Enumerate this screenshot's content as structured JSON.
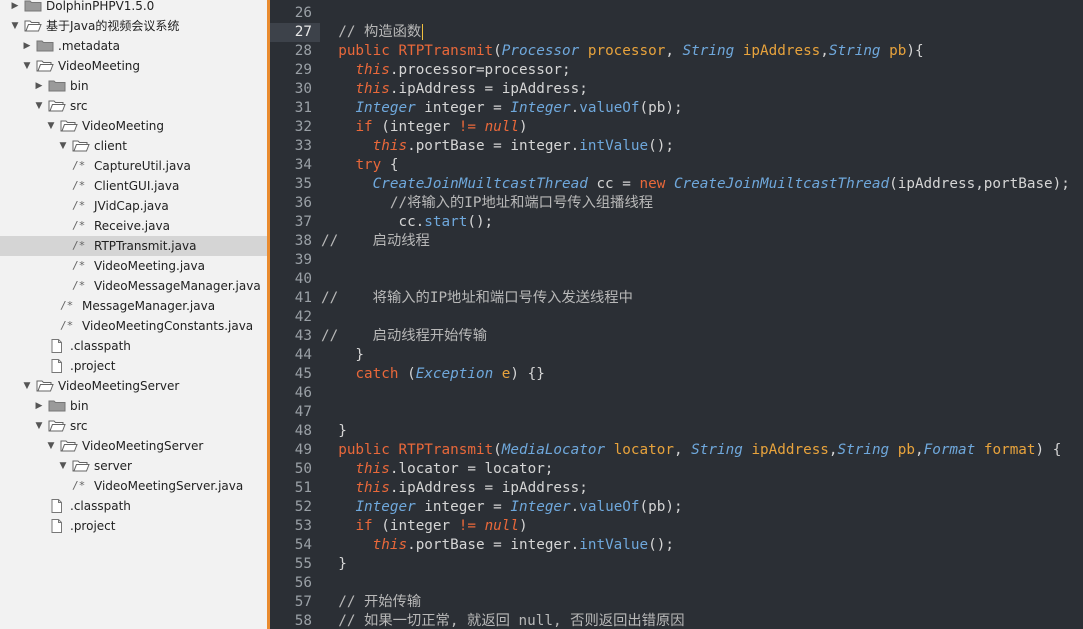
{
  "sidebar": {
    "items": [
      {
        "label": "DolphinPHPV1.5.0",
        "kind": "folder",
        "depth": 0,
        "expanded": false,
        "arrow": true
      },
      {
        "label": "基于Java的视频会议系统",
        "kind": "folder",
        "depth": 0,
        "expanded": true,
        "arrow": true
      },
      {
        "label": ".metadata",
        "kind": "folder",
        "depth": 1,
        "expanded": false,
        "arrow": true
      },
      {
        "label": "VideoMeeting",
        "kind": "folder",
        "depth": 1,
        "expanded": true,
        "arrow": true
      },
      {
        "label": "bin",
        "kind": "folder",
        "depth": 2,
        "expanded": false,
        "arrow": true
      },
      {
        "label": "src",
        "kind": "folder",
        "depth": 2,
        "expanded": true,
        "arrow": true
      },
      {
        "label": "VideoMeeting",
        "kind": "folder",
        "depth": 3,
        "expanded": true,
        "arrow": true
      },
      {
        "label": "client",
        "kind": "folder",
        "depth": 4,
        "expanded": true,
        "arrow": true
      },
      {
        "label": "CaptureUtil.java",
        "kind": "java",
        "depth": 5
      },
      {
        "label": "ClientGUI.java",
        "kind": "java",
        "depth": 5
      },
      {
        "label": "JVidCap.java",
        "kind": "java",
        "depth": 5
      },
      {
        "label": "Receive.java",
        "kind": "java",
        "depth": 5
      },
      {
        "label": "RTPTransmit.java",
        "kind": "java",
        "depth": 5,
        "selected": true
      },
      {
        "label": "VideoMeeting.java",
        "kind": "java",
        "depth": 5
      },
      {
        "label": "VideoMessageManager.java",
        "kind": "java",
        "depth": 5
      },
      {
        "label": "MessageManager.java",
        "kind": "java",
        "depth": 4
      },
      {
        "label": "VideoMeetingConstants.java",
        "kind": "java",
        "depth": 4
      },
      {
        "label": ".classpath",
        "kind": "file",
        "depth": 2
      },
      {
        "label": ".project",
        "kind": "file",
        "depth": 2
      },
      {
        "label": "VideoMeetingServer",
        "kind": "folder",
        "depth": 1,
        "expanded": true,
        "arrow": true
      },
      {
        "label": "bin",
        "kind": "folder",
        "depth": 2,
        "expanded": false,
        "arrow": true
      },
      {
        "label": "src",
        "kind": "folder",
        "depth": 2,
        "expanded": true,
        "arrow": true
      },
      {
        "label": "VideoMeetingServer",
        "kind": "folder",
        "depth": 3,
        "expanded": true,
        "arrow": true
      },
      {
        "label": "server",
        "kind": "folder",
        "depth": 4,
        "expanded": true,
        "arrow": true
      },
      {
        "label": "VideoMeetingServer.java",
        "kind": "java",
        "depth": 5
      },
      {
        "label": ".classpath",
        "kind": "file",
        "depth": 2
      },
      {
        "label": ".project",
        "kind": "file",
        "depth": 2
      }
    ],
    "java_icon_glyph": "/*"
  },
  "editor": {
    "current_line": 27,
    "lines": [
      {
        "n": "26",
        "html": ""
      },
      {
        "n": "27",
        "html": "  <span class=\"cm\">// 构造函数</span><span class=\"cursor\"></span>"
      },
      {
        "n": "28",
        "html": "  <span class=\"kw\">public</span> <span class=\"fn\">RTPTransmit</span>(<span class=\"ty\">Processor</span> <span class=\"prm\">processor</span>, <span class=\"ty\">String</span> <span class=\"prm\">ipAddress</span>,<span class=\"ty\">String</span> <span class=\"prm\">pb</span>){"
      },
      {
        "n": "29",
        "html": "    <span class=\"kw2\">this</span>.processor=processor;"
      },
      {
        "n": "30",
        "html": "    <span class=\"kw2\">this</span>.ipAddress = ipAddress;"
      },
      {
        "n": "31",
        "html": "    <span class=\"ty\">Integer</span> integer = <span class=\"ty\">Integer</span>.<span class=\"mt\">valueOf</span>(pb);"
      },
      {
        "n": "32",
        "html": "    <span class=\"kw\">if</span> (integer <span class=\"kw\">!=</span> <span class=\"kw2\">null</span>)"
      },
      {
        "n": "33",
        "html": "      <span class=\"kw2\">this</span>.portBase = integer.<span class=\"mt\">intValue</span>();"
      },
      {
        "n": "34",
        "html": "    <span class=\"kw\">try</span> {"
      },
      {
        "n": "35",
        "html": "      <span class=\"ty\">CreateJoinMuiltcastThread</span> cc = <span class=\"kw\">new</span> <span class=\"ty\">CreateJoinMuiltcastThread</span>(ipAddress,portBase);"
      },
      {
        "n": "36",
        "html": "        <span class=\"cm\">//将输入的IP地址和端口号传入组播线程</span>"
      },
      {
        "n": "37",
        "html": "         cc.<span class=\"mt\">start</span>();"
      },
      {
        "n": "38",
        "html": "<span class=\"cm\">//    启动线程</span>"
      },
      {
        "n": "39",
        "html": ""
      },
      {
        "n": "40",
        "html": ""
      },
      {
        "n": "41",
        "html": "<span class=\"cm\">//    将输入的IP地址和端口号传入发送线程中</span>"
      },
      {
        "n": "42",
        "html": ""
      },
      {
        "n": "43",
        "html": "<span class=\"cm\">//    启动线程开始传输</span>"
      },
      {
        "n": "44",
        "html": "    }"
      },
      {
        "n": "45",
        "html": "    <span class=\"kw\">catch</span> (<span class=\"ty\">Exception</span> <span class=\"prm\">e</span>) {}"
      },
      {
        "n": "46",
        "html": ""
      },
      {
        "n": "47",
        "html": ""
      },
      {
        "n": "48",
        "html": "  }"
      },
      {
        "n": "49",
        "html": "  <span class=\"kw\">public</span> <span class=\"fn\">RTPTransmit</span>(<span class=\"ty\">MediaLocator</span> <span class=\"prm\">locator</span>, <span class=\"ty\">String</span> <span class=\"prm\">ipAddress</span>,<span class=\"ty\">String</span> <span class=\"prm\">pb</span>,<span class=\"ty\">Format</span> <span class=\"prm\">format</span>) {"
      },
      {
        "n": "50",
        "html": "    <span class=\"kw2\">this</span>.locator = locator;"
      },
      {
        "n": "51",
        "html": "    <span class=\"kw2\">this</span>.ipAddress = ipAddress;"
      },
      {
        "n": "52",
        "html": "    <span class=\"ty\">Integer</span> integer = <span class=\"ty\">Integer</span>.<span class=\"mt\">valueOf</span>(pb);"
      },
      {
        "n": "53",
        "html": "    <span class=\"kw\">if</span> (integer <span class=\"kw\">!=</span> <span class=\"kw2\">null</span>)"
      },
      {
        "n": "54",
        "html": "      <span class=\"kw2\">this</span>.portBase = integer.<span class=\"mt\">intValue</span>();"
      },
      {
        "n": "55",
        "html": "  }"
      },
      {
        "n": "56",
        "html": ""
      },
      {
        "n": "57",
        "html": "  <span class=\"cm\">// 开始传输</span>"
      },
      {
        "n": "58",
        "html": "  <span class=\"cm\">// 如果一切正常, 就返回 null, 否则返回出错原因</span>"
      }
    ]
  },
  "colors": {
    "sidebar_bg": "#f2f2f2",
    "selected_row": "#d5d5d5",
    "splitter": "#e98b2f",
    "editor_bg": "#2b2f35",
    "keyword": "#e9683a",
    "type": "#6fa8dc",
    "param": "#e8a33c"
  }
}
